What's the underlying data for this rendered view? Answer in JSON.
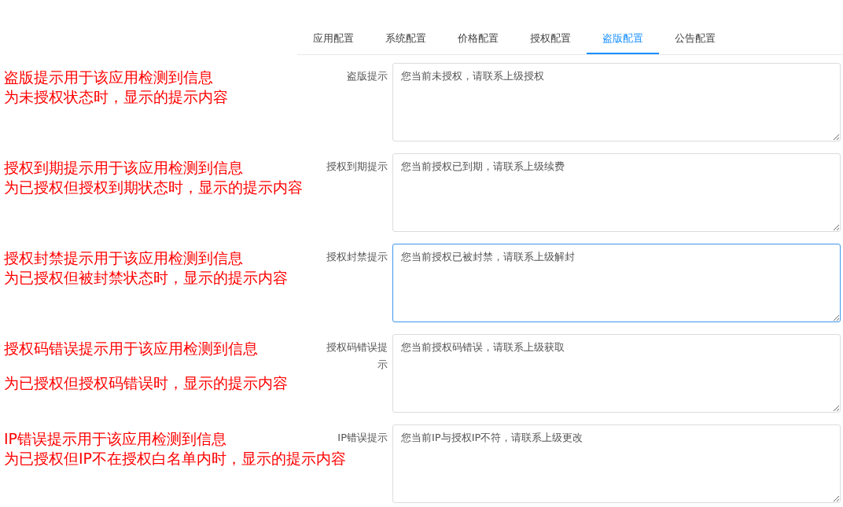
{
  "tabs": [
    {
      "label": "应用配置",
      "selected": false
    },
    {
      "label": "系统配置",
      "selected": false
    },
    {
      "label": "价格配置",
      "selected": false
    },
    {
      "label": "授权配置",
      "selected": false
    },
    {
      "label": "盗版配置",
      "selected": true
    },
    {
      "label": "公告配置",
      "selected": false
    }
  ],
  "fields": [
    {
      "note": [
        "盗版提示用于该应用检测到信息",
        "为未授权状态时，显示的提示内容"
      ],
      "label": "盗版提示",
      "value": "您当前未授权，请联系上级授权",
      "focused": false
    },
    {
      "note": [
        "授权到期提示用于该应用检测到信息",
        "为已授权但授权到期状态时，显示的提示内容"
      ],
      "label": "授权到期提示",
      "value": "您当前授权已到期，请联系上级续费",
      "focused": false
    },
    {
      "note": [
        "授权封禁提示用于该应用检测到信息",
        "为已授权但被封禁状态时，显示的提示内容"
      ],
      "label": "授权封禁提示",
      "value": "您当前授权已被封禁，请联系上级解封",
      "focused": true
    },
    {
      "note": [
        "授权码错误提示用于该应用检测到信息",
        "为已授权但授权码错误时，显示的提示内容"
      ],
      "label": "授权码错误提示",
      "value": "您当前授权码错误，请联系上级获取",
      "focused": false
    },
    {
      "note": [
        "IP错误提示用于该应用检测到信息",
        "为已授权但IP不在授权白名单内时，显示的提示内容"
      ],
      "label": "IP错误提示",
      "value": "您当前IP与授权IP不符，请联系上级更改",
      "focused": false
    }
  ]
}
